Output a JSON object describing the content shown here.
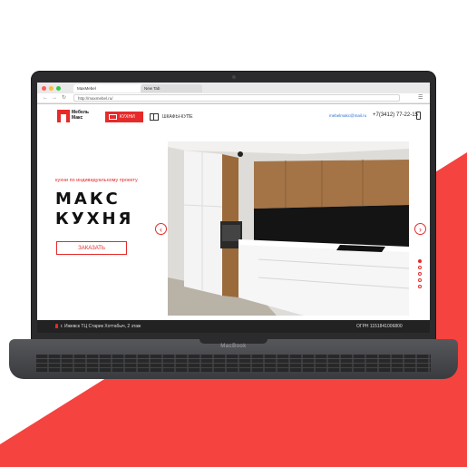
{
  "colors": {
    "accent": "#e62a2a",
    "laptop": "#2b2b2d",
    "footer": "#222222"
  },
  "laptop": {
    "brand": "MacBook"
  },
  "browser": {
    "tabs": [
      {
        "label": "MaxMebel"
      },
      {
        "label": "New Tab"
      }
    ],
    "address": "http://maxmebel.ru/",
    "back_icon": "back-arrow-icon",
    "forward_icon": "forward-arrow-icon",
    "reload_icon": "reload-icon",
    "menu_icon": "hamburger-menu-icon"
  },
  "site": {
    "logo": {
      "line1": "Мебель",
      "line2": "Макс"
    },
    "nav": [
      {
        "label": "КУХНИ",
        "active": true
      },
      {
        "label": "ШКАФЫ-КУПЕ",
        "active": false
      }
    ],
    "email": "mebelmakc@mail.ru",
    "phone": "+7(3412) 77-22-15"
  },
  "hero": {
    "subtitle": "кухни по индивидуальному проекту",
    "title_line1": "МАКС",
    "title_line2": "КУХНЯ",
    "cta": "ЗАКАЗАТЬ",
    "prev_icon": "chevron-left-icon",
    "next_icon": "chevron-right-icon",
    "slides_total": 5,
    "slide_active": 1
  },
  "footer": {
    "address": "г. Ижевск ТЦ Старик Хоттабыч, 2 этаж",
    "ogrn": "ОГРН 1151841006800"
  }
}
